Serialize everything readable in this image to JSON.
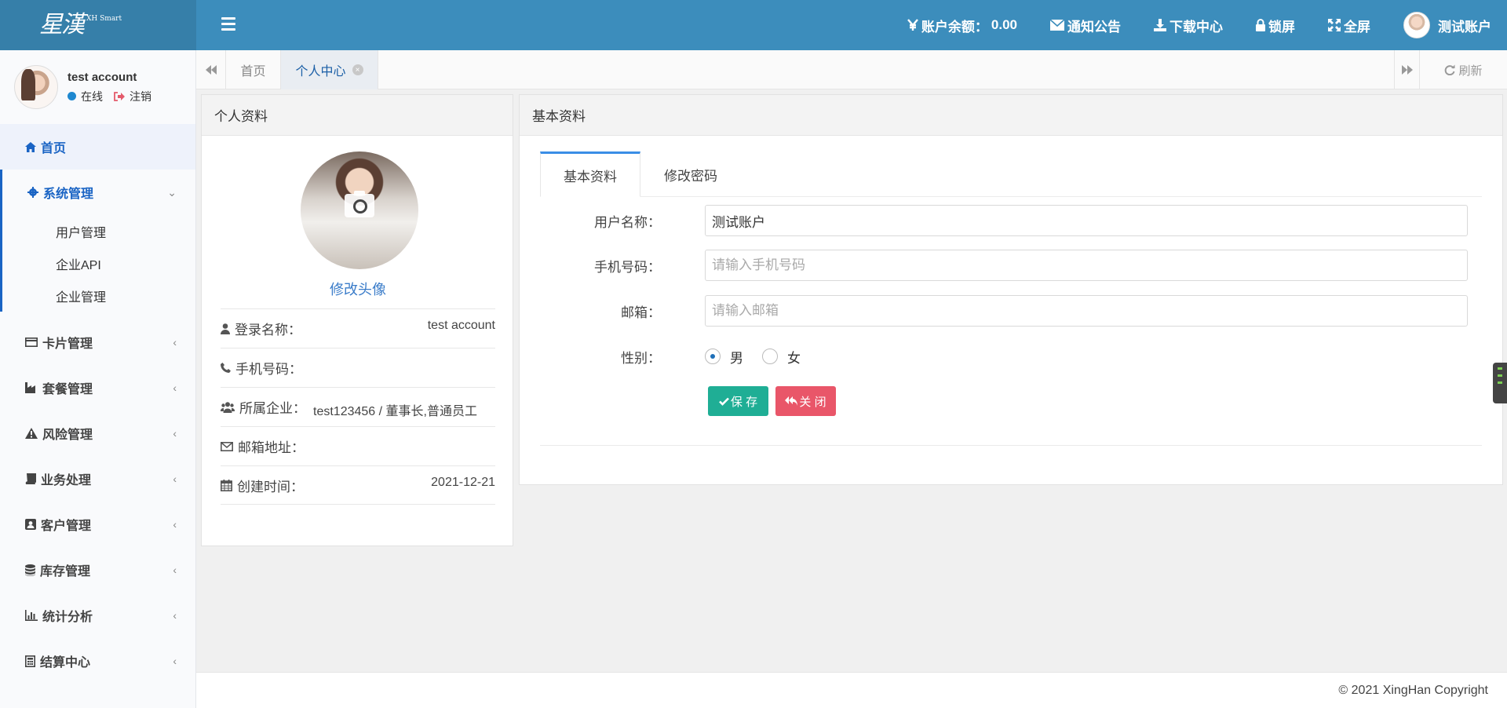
{
  "header": {
    "logo_text": "星漢",
    "logo_small": "XH Smart",
    "balance_label": "账户余额：",
    "balance_value": "0.00",
    "notice": "通知公告",
    "download": "下载中心",
    "lock": "锁屏",
    "fullscreen": "全屏",
    "account": "测试账户"
  },
  "sidebar": {
    "user_name": "test account",
    "status": "在线",
    "logout": "注销",
    "menu": {
      "home": "首页",
      "system": "系统管理",
      "sub_user": "用户管理",
      "sub_api": "企业API",
      "sub_company": "企业管理",
      "card": "卡片管理",
      "package": "套餐管理",
      "risk": "风险管理",
      "business": "业务处理",
      "customer": "客户管理",
      "stock": "库存管理",
      "stats": "统计分析",
      "settle": "结算中心"
    }
  },
  "tabs": {
    "home": "首页",
    "profile": "个人中心",
    "refresh": "刷新"
  },
  "profile": {
    "title": "个人资料",
    "change_avatar": "修改头像",
    "login_label": "登录名称：",
    "login_value": "test account",
    "phone_label": "手机号码：",
    "phone_value": "",
    "company_label": "所属企业：",
    "company_value": "test123456 / 董事长,普通员工",
    "email_label": "邮箱地址：",
    "email_value": "",
    "created_label": "创建时间：",
    "created_value": "2021-12-21"
  },
  "basic": {
    "title": "基本资料",
    "tab_basic": "基本资料",
    "tab_password": "修改密码",
    "username_label": "用户名称：",
    "username_value": "测试账户",
    "phone_label": "手机号码：",
    "phone_placeholder": "请输入手机号码",
    "email_label": "邮箱：",
    "email_placeholder": "请输入邮箱",
    "gender_label": "性别：",
    "gender_male": "男",
    "gender_female": "女",
    "save": "保 存",
    "close": "关 闭"
  },
  "footer": {
    "copyright": "© 2021 XingHan Copyright"
  }
}
